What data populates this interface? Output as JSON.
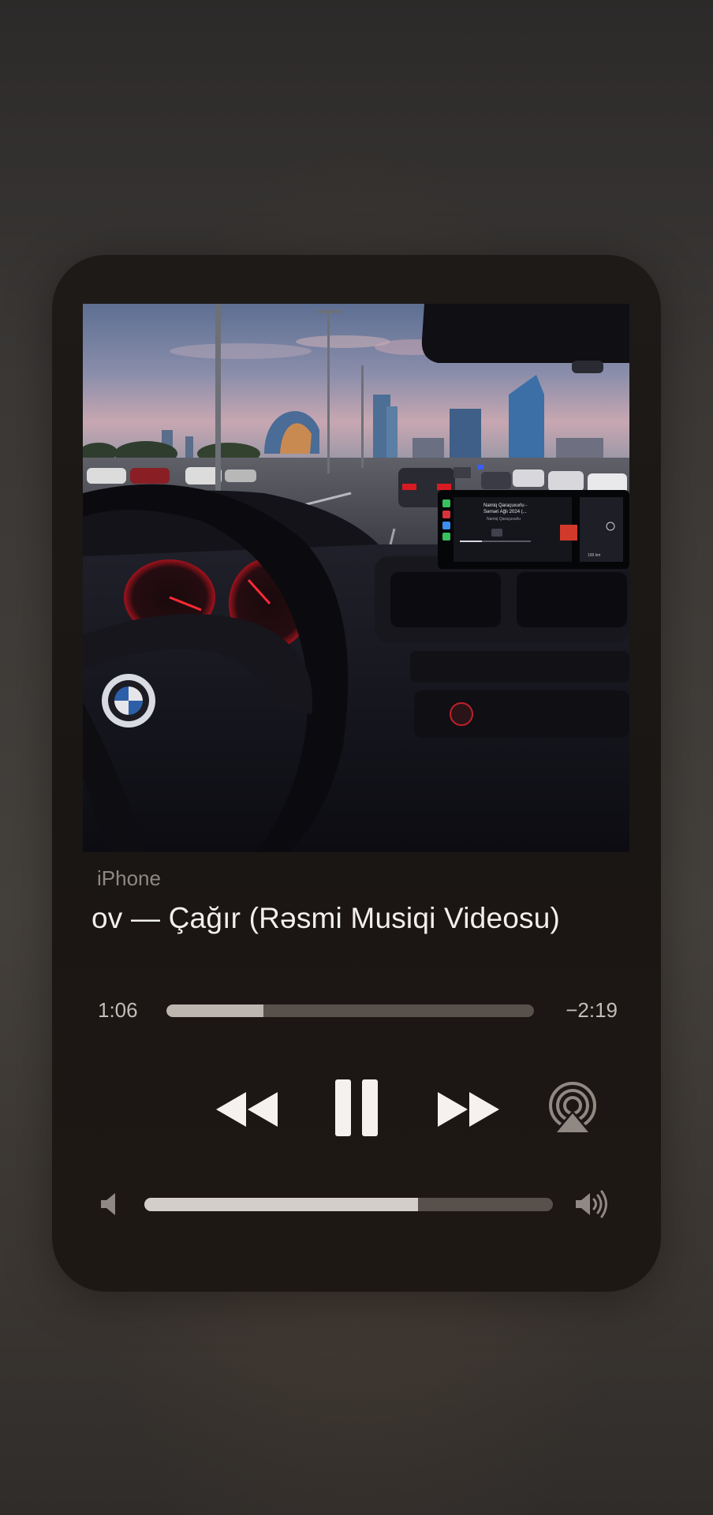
{
  "player": {
    "device_name": "iPhone",
    "title_visible": "ov — Çağır (Rəsmi Musiqi Videosu)",
    "time_elapsed": "1:06",
    "time_remaining": "−2:19",
    "progress_fraction": 0.265,
    "volume_fraction": 0.67
  },
  "artwork": {
    "carplay_song": "Namiq Qaraçuxurlu -",
    "carplay_song_line2": "Sərnəri Ağlı 2024 (...",
    "carplay_artist": "Namiq Qaraçuxurlu",
    "carplay_speed": "100 km"
  },
  "icons": {
    "rewind": "rewind-icon",
    "pause": "pause-icon",
    "forward": "fast-forward-icon",
    "airplay": "airplay-icon",
    "volume_low": "speaker-low-icon",
    "volume_high": "speaker-high-icon"
  },
  "colors": {
    "card_bg": "#1c1816",
    "track_bg": "#57504b",
    "track_fill": "#bcb5b0",
    "text_primary": "#f2efec"
  }
}
